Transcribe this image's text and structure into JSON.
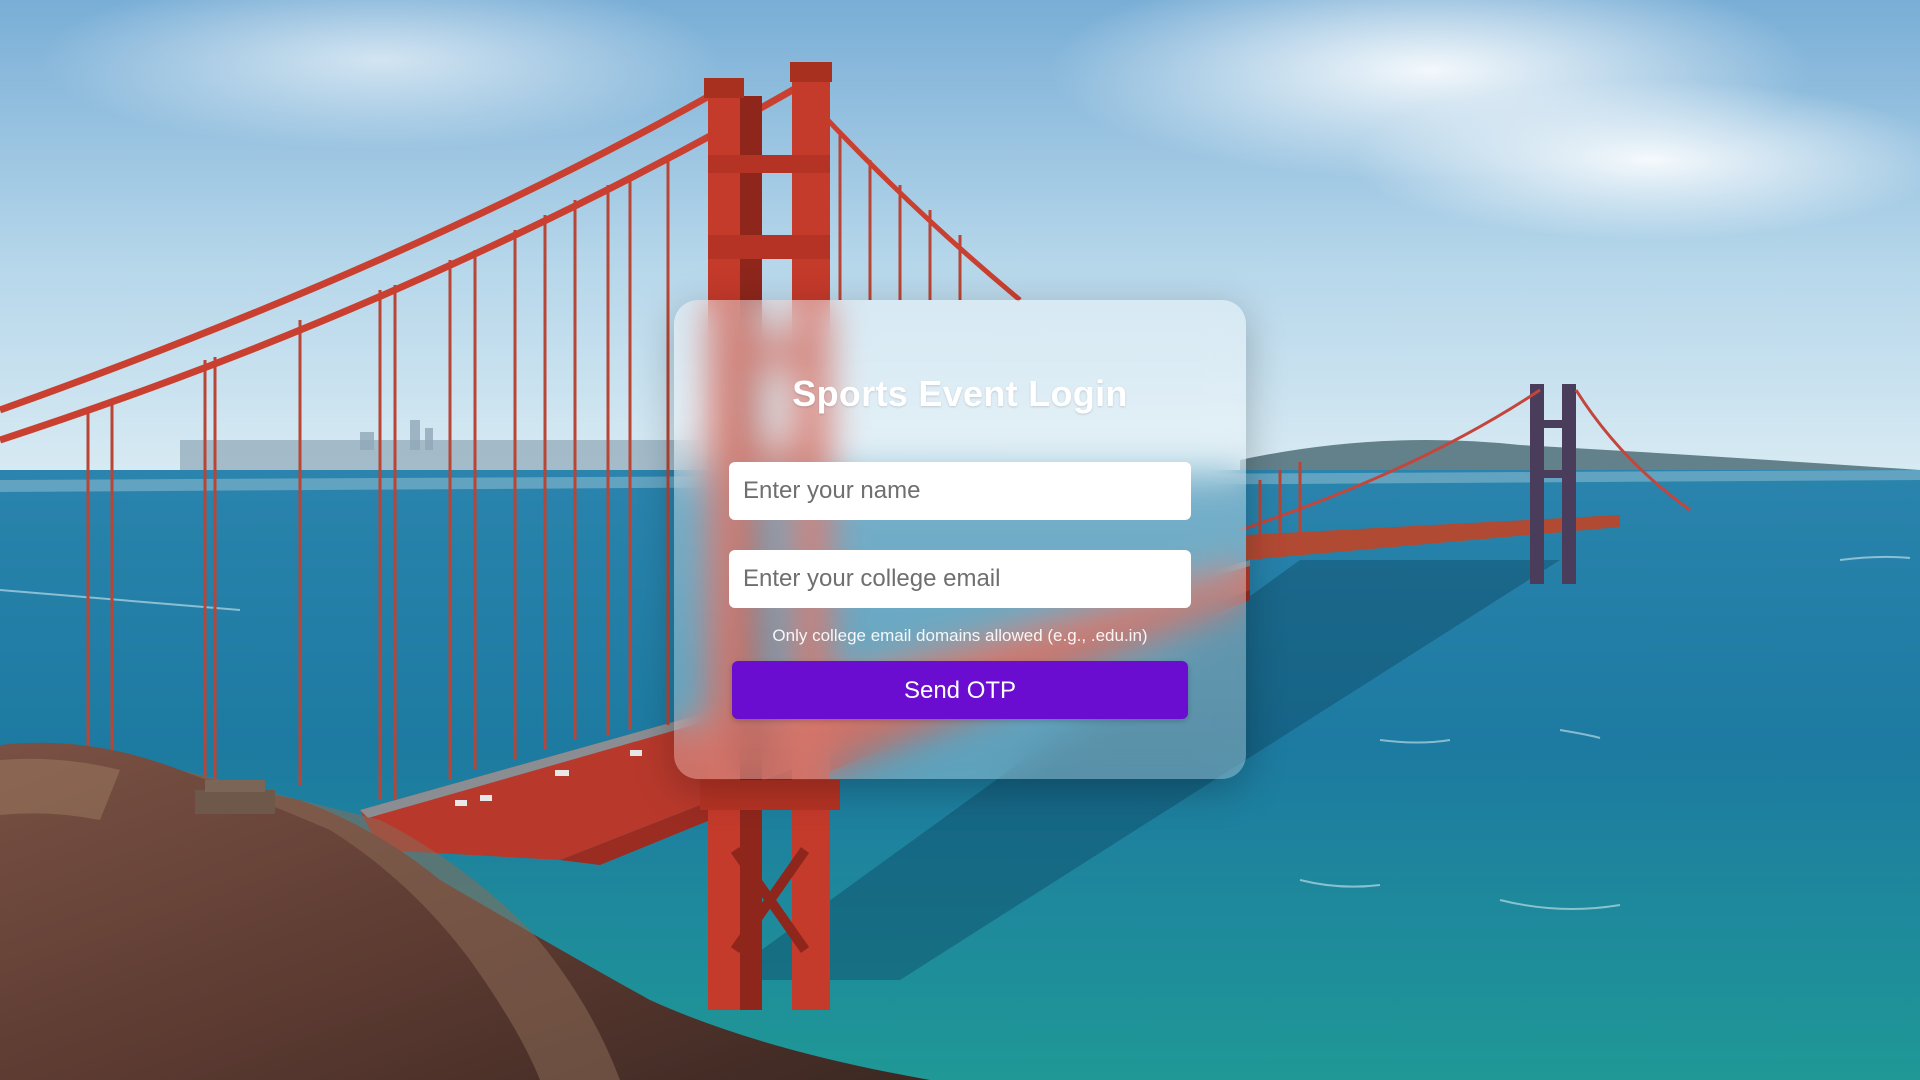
{
  "page": {
    "background": "golden-gate-bridge-photo",
    "accent_color": "#6a0dd0"
  },
  "login": {
    "title": "Sports Event Login",
    "name_placeholder": "Enter your name",
    "email_placeholder": "Enter your college email",
    "hint": "Only college email domains allowed (e.g., .edu.in)",
    "send_button": "Send OTP"
  }
}
